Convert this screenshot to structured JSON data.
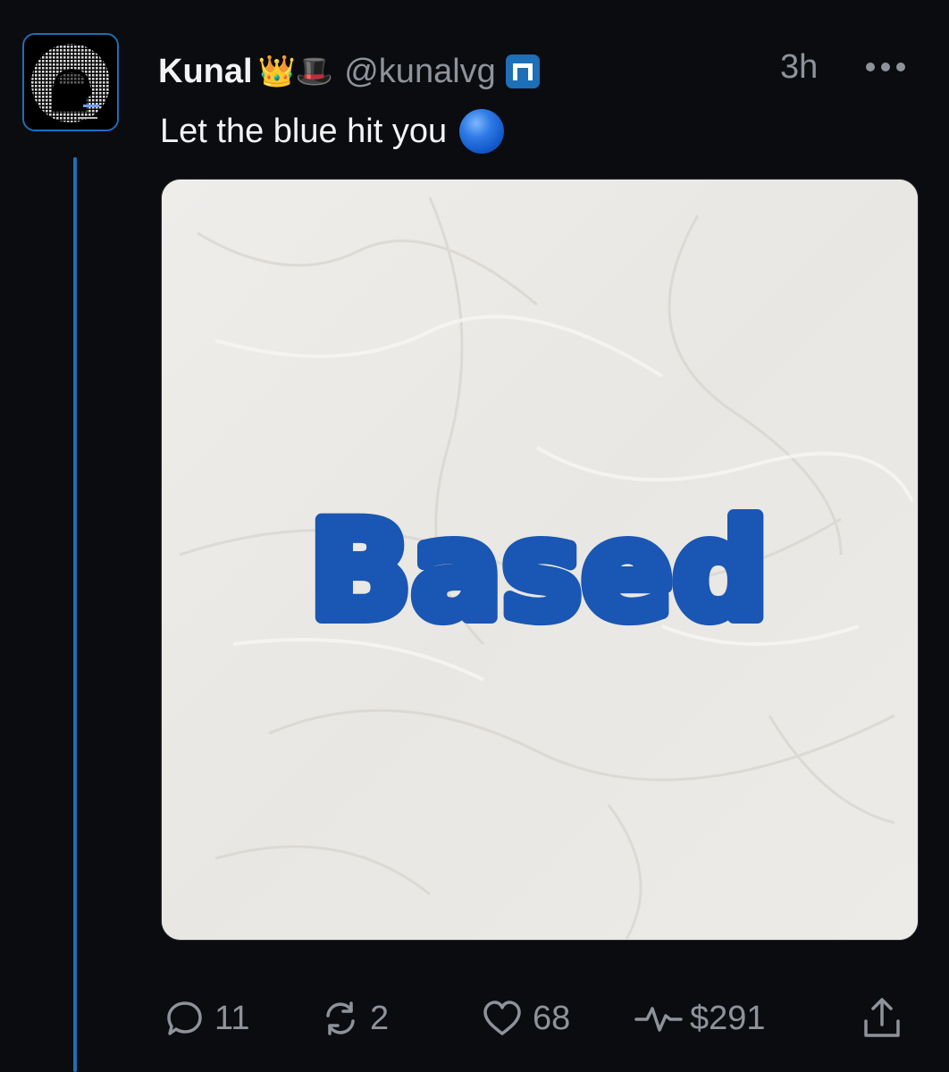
{
  "post": {
    "author_name": "Kunal",
    "author_emojis": "👑🎩",
    "handle": "@kunalvg",
    "time": "3h",
    "text": "Let the blue hit you",
    "media_text": "Based",
    "colors": {
      "thread_line": "#1d6fb8",
      "media_text": "#1a56b3",
      "badge": "#1d6fb8"
    }
  },
  "actions": {
    "reply_count": "11",
    "repost_count": "2",
    "like_count": "68",
    "tips_value": "$291"
  },
  "icons": {
    "avatar": "pixel-avatar",
    "badge": "verified-badge-icon",
    "more": "more-icon",
    "reply": "reply-icon",
    "repost": "repost-icon",
    "like": "heart-icon",
    "tips": "activity-icon",
    "share": "share-icon"
  }
}
